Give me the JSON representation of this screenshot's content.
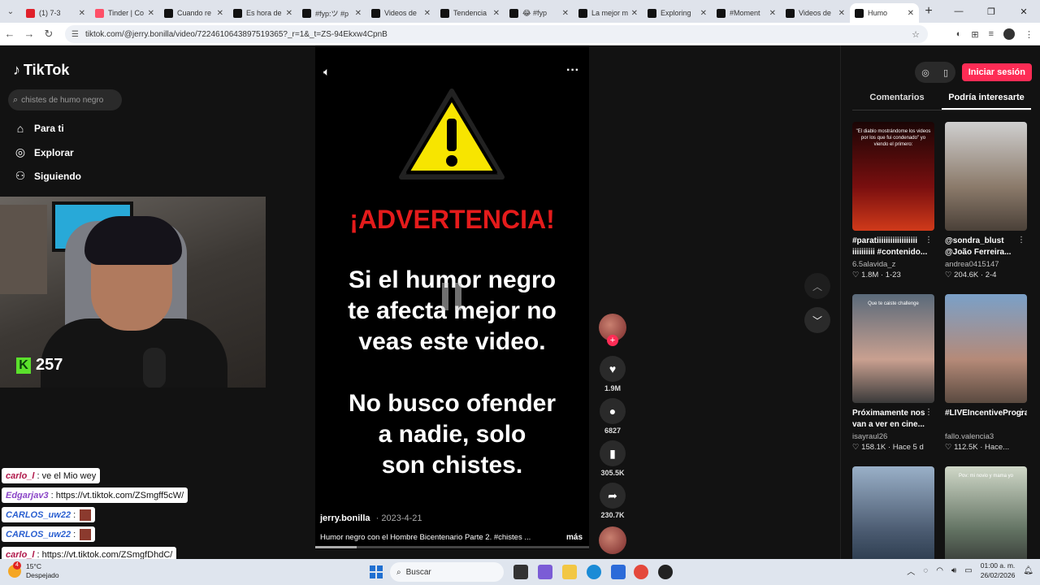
{
  "browser": {
    "tabs": [
      {
        "label": "(1) 7-3",
        "active": false
      },
      {
        "label": "Tinder | Co",
        "active": false
      },
      {
        "label": "Cuando re",
        "active": false
      },
      {
        "label": "Es hora de",
        "active": false
      },
      {
        "label": "#fyp:ツ #p",
        "active": false
      },
      {
        "label": "Videos de",
        "active": false
      },
      {
        "label": "Tendencia",
        "active": false
      },
      {
        "label": "😂 #fyp",
        "active": false
      },
      {
        "label": "La mejor m",
        "active": false
      },
      {
        "label": "Exploring",
        "active": false
      },
      {
        "label": "#Moment",
        "active": false
      },
      {
        "label": "Videos de",
        "active": false
      },
      {
        "label": "Humo",
        "active": true
      }
    ],
    "url": "tiktok.com/@jerry.bonilla/video/7224610643897519365?_r=1&_t=ZS-94Ekxw4CpnB"
  },
  "sidebar": {
    "logo": "TikTok",
    "search_placeholder": "chistes de humo negro",
    "nav": [
      {
        "label": "Para ti",
        "icon": "home-icon"
      },
      {
        "label": "Explorar",
        "icon": "compass-icon"
      },
      {
        "label": "Siguiendo",
        "icon": "person-icon"
      }
    ]
  },
  "stream": {
    "badge_count": "257",
    "chat": [
      {
        "user": "carlo_l",
        "text": ": ve el Mio wey",
        "user_color": "#b0184a",
        "emote": false
      },
      {
        "user": "Edgarjav3",
        "text": ": https://vt.tiktok.com/ZSmgff5cW/",
        "user_color": "#8a45c7",
        "emote": false
      },
      {
        "user": "CARLOS_uw22",
        "text": ":",
        "user_color": "#2a5fd0",
        "emote": true
      },
      {
        "user": "CARLOS_uw22",
        "text": ":",
        "user_color": "#2a5fd0",
        "emote": true
      },
      {
        "user": "carlo_l",
        "text": ": https://vt.tiktok.com/ZSmgfDhdC/",
        "user_color": "#b0184a",
        "emote": false
      }
    ]
  },
  "video": {
    "warning_title": "¡ADVERTENCIA!",
    "text_line1": "Si el humor negro",
    "text_line2": "te afecta mejor no",
    "text_line3": "veas este video.",
    "text_line4": "No busco ofender",
    "text_line5": "a nadie, solo",
    "text_line6": "son chistes.",
    "author": "jerry.bonilla",
    "date": "2023-4-21",
    "description": "Humor negro con el Hombre Bicentenario Parte 2. #chistes ...",
    "more_label": "más",
    "progress": 0.15
  },
  "actions": {
    "likes": "1.9M",
    "comments": "6827",
    "saves": "305.5K",
    "shares": "230.7K"
  },
  "right_panel": {
    "login_label": "Iniciar sesión",
    "tab_comments": "Comentarios",
    "tab_recommend": "Podría interesarte",
    "cards": [
      {
        "title": "#paratiiiiiiiiiiiiiiiiii iiiiiiiiii #contenido...",
        "author": "6.5alavida_z",
        "stats": "♡ 1.8M · 1-23",
        "thumb_text": "\"El diablo mostrándome los videos por los que fui condenado\"  yo viendo el primero:"
      },
      {
        "title": "@sondra_blust @João Ferreira...",
        "author": "andrea0415147",
        "stats": "♡ 204.6K · 2-4",
        "thumb_text": ""
      },
      {
        "title": "Próximamente nos van a ver en cine...",
        "author": "isayraul26",
        "stats": "♡ 158.1K · Hace 5 d",
        "thumb_text": "Que te caiste challenge"
      },
      {
        "title": "#LIVEIncentiveProgram...",
        "author": "fallo.valencia3",
        "stats": "♡ 112.5K · Hace...",
        "thumb_text": ""
      },
      {
        "title": "",
        "author": "",
        "stats": "",
        "thumb_text": ""
      },
      {
        "title": "",
        "author": "",
        "stats": "",
        "thumb_text": "Pov: mi novio y mama yo"
      }
    ]
  },
  "taskbar": {
    "temp": "15°C",
    "weather": "Despejado",
    "weather_badge": "4",
    "search_label": "Buscar",
    "time": "01:00 a. m.",
    "date": "26/02/2026"
  }
}
